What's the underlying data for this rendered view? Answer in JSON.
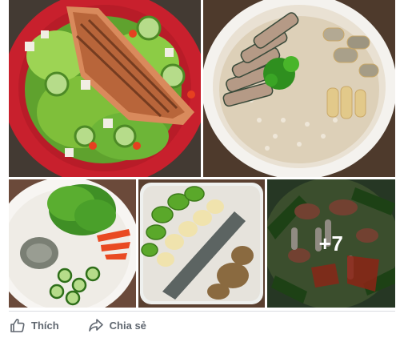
{
  "post": {
    "photos": [
      {
        "dish": "salmon-salad"
      },
      {
        "dish": "oatmeal-bowl"
      },
      {
        "dish": "salad-plate"
      },
      {
        "dish": "yogurt-bowl"
      },
      {
        "dish": "mushroom-hotpot"
      }
    ],
    "more_count": "+7"
  },
  "actions": {
    "like_label": "Thích",
    "share_label": "Chia sẻ",
    "like_icon": "thumbs-up-icon",
    "share_icon": "share-arrow-icon"
  },
  "colors": {
    "action_text": "#606770",
    "divider": "#dadde1",
    "plate_red": "#c8202d"
  }
}
